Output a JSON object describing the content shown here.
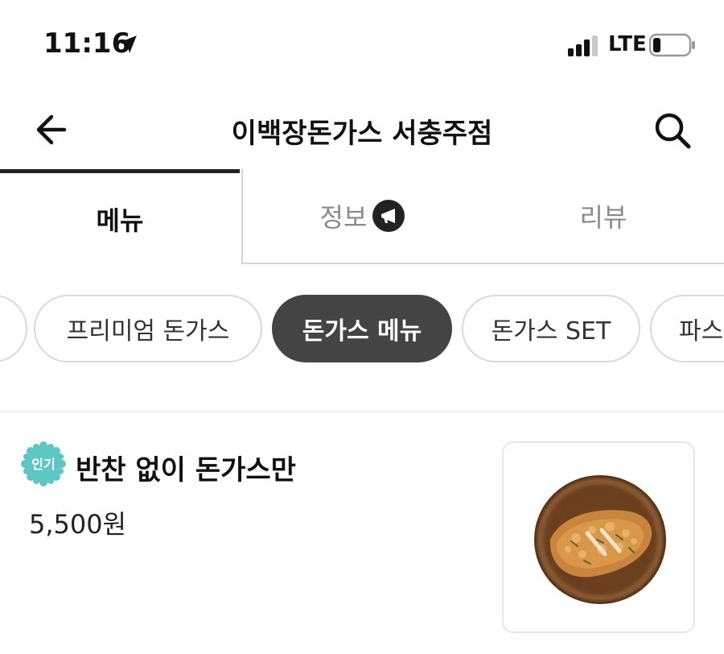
{
  "status_bar": {
    "time": "11:16",
    "network": "LTE",
    "icons": [
      "location-arrow-icon",
      "signal-icon",
      "battery-icon"
    ]
  },
  "header": {
    "title": "이백장돈가스 서충주점",
    "icons": [
      "back-arrow-icon",
      "search-icon"
    ]
  },
  "tabs": [
    {
      "label": "메뉴",
      "active": true
    },
    {
      "label": "정보",
      "active": false,
      "icon": "megaphone-icon"
    },
    {
      "label": "리뷰",
      "active": false
    }
  ],
  "categories": [
    {
      "label": "",
      "active": false
    },
    {
      "label": "프리미엄 돈가스",
      "active": false
    },
    {
      "label": "돈가스 메뉴",
      "active": true
    },
    {
      "label": "돈가스 SET",
      "active": false
    },
    {
      "label": "파스",
      "active": false
    }
  ],
  "menu_items": [
    {
      "badge": "인기",
      "name": "반찬 없이 돈가스만",
      "price": "5,500원",
      "image": "tonkatsu-plate"
    }
  ],
  "colors": {
    "accent_dark": "#444444",
    "badge_teal": "#5ec7c4",
    "tab_inactive": "#8a8a8a"
  }
}
